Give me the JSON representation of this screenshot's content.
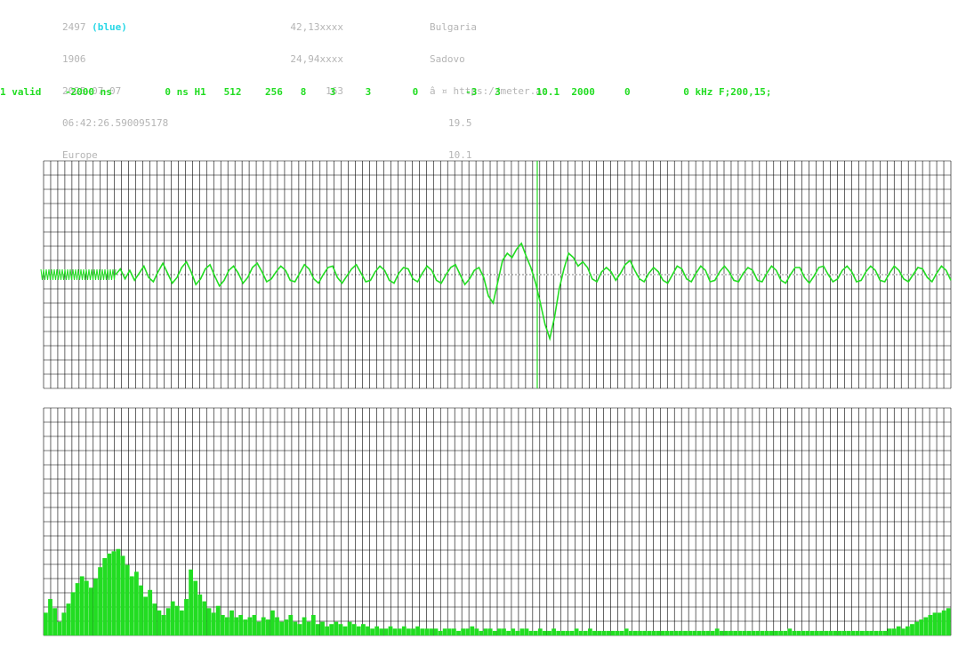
{
  "header": {
    "col1": {
      "id": "2497",
      "color_tag": "(blue)",
      "line2": "1906",
      "date": "2025-07-07",
      "time": "06:42:26.590095178",
      "region": "Europe"
    },
    "col2": {
      "lat": "42,13xxxx",
      "lon": "24,94xxxx",
      "value": "163"
    },
    "col3": {
      "country": "Bulgaria",
      "city": "Sadovo",
      "url": "â ¤ https://meter.ac",
      "val1": "19.5",
      "val2": "10.1"
    }
  },
  "status_line": "1 valid    -2000 ns         0 ns H1   512    256   8    3     3       0        -3   3      10.1  2000     0         0 kHz F;200,15;",
  "colors": {
    "signal": "#22dd22",
    "grid": "#000000",
    "header_text": "#b5b5b5",
    "accent": "#28d7e6"
  },
  "chart_data": [
    {
      "type": "line",
      "title": "",
      "xlabel": "",
      "ylabel": "",
      "x_range": [
        -2000,
        0
      ],
      "x_unit": "ns",
      "ylim": [
        -8,
        8
      ],
      "grid": true,
      "marker_line_x": -1000,
      "series": [
        {
          "values": [
            0,
            0.4,
            -0.3,
            0.3,
            -0.4,
            0.1,
            0.6,
            -0.2,
            -0.5,
            0.2,
            0.8,
            0.1,
            -0.6,
            -0.2,
            0.5,
            0.9,
            0.2,
            -0.7,
            -0.3,
            0.4,
            0.7,
            -0.1,
            -0.8,
            -0.4,
            0.3,
            0.6,
            0.1,
            -0.6,
            -0.2,
            0.5,
            0.8,
            0.2,
            -0.5,
            -0.3,
            0.2,
            0.6,
            0.3,
            -0.4,
            -0.5,
            0.1,
            0.7,
            0.4,
            -0.3,
            -0.6,
            0.0,
            0.5,
            0.6,
            -0.2,
            -0.6,
            -0.1,
            0.4,
            0.7,
            0.1,
            -0.5,
            -0.4,
            0.2,
            0.6,
            0.3,
            -0.4,
            -0.6,
            0.1,
            0.5,
            0.4,
            -0.3,
            -0.5,
            0.1,
            0.6,
            0.3,
            -0.4,
            -0.6,
            0.0,
            0.5,
            0.7,
            0.0,
            -0.7,
            -0.3,
            0.3,
            0.5,
            -0.2,
            -1.5,
            -2.0,
            -0.5,
            1.0,
            1.5,
            1.2,
            1.8,
            2.2,
            1.3,
            0.5,
            -0.6,
            -2.0,
            -3.5,
            -4.5,
            -3.0,
            -1.0,
            0.4,
            1.5,
            1.2,
            0.6,
            0.9,
            0.5,
            -0.3,
            -0.5,
            0.2,
            0.5,
            0.2,
            -0.4,
            0.1,
            0.7,
            1.0,
            0.3,
            -0.3,
            -0.5,
            0.1,
            0.5,
            0.2,
            -0.4,
            -0.6,
            0.0,
            0.6,
            0.4,
            -0.3,
            -0.5,
            0.1,
            0.6,
            0.3,
            -0.5,
            -0.4,
            0.2,
            0.6,
            0.2,
            -0.4,
            -0.5,
            0.1,
            0.5,
            0.3,
            -0.4,
            -0.5,
            0.1,
            0.6,
            0.3,
            -0.4,
            -0.6,
            0.0,
            0.5,
            0.5,
            -0.2,
            -0.6,
            -0.1,
            0.5,
            0.6,
            0.0,
            -0.5,
            -0.3,
            0.3,
            0.6,
            0.2,
            -0.5,
            -0.4,
            0.2,
            0.6,
            0.3,
            -0.4,
            -0.5,
            0.1,
            0.6,
            0.3,
            -0.3,
            -0.5,
            0.0,
            0.5,
            0.4,
            -0.2,
            -0.5,
            0.1,
            0.6,
            0.3,
            -0.4
          ]
        }
      ]
    },
    {
      "type": "bar",
      "title": "",
      "xlabel": "",
      "ylabel": "",
      "x_range": [
        0,
        200
      ],
      "x_unit": "kHz",
      "ylim": [
        0,
        10
      ],
      "grid": true,
      "values": [
        1.0,
        1.6,
        1.2,
        0.6,
        1.0,
        1.4,
        1.9,
        2.3,
        2.6,
        2.4,
        2.1,
        2.5,
        3.0,
        3.4,
        3.6,
        3.7,
        3.8,
        3.5,
        3.1,
        2.6,
        2.8,
        2.2,
        1.7,
        2.0,
        1.4,
        1.1,
        0.9,
        1.2,
        1.5,
        1.3,
        1.1,
        1.6,
        2.9,
        2.4,
        1.8,
        1.5,
        1.2,
        1.0,
        1.3,
        0.9,
        0.8,
        1.1,
        0.8,
        0.9,
        0.7,
        0.8,
        0.9,
        0.6,
        0.8,
        0.7,
        1.1,
        0.8,
        0.6,
        0.7,
        0.9,
        0.6,
        0.5,
        0.8,
        0.6,
        0.9,
        0.5,
        0.6,
        0.4,
        0.5,
        0.6,
        0.5,
        0.4,
        0.6,
        0.5,
        0.4,
        0.5,
        0.4,
        0.3,
        0.4,
        0.3,
        0.3,
        0.4,
        0.3,
        0.3,
        0.4,
        0.3,
        0.3,
        0.4,
        0.3,
        0.3,
        0.3,
        0.3,
        0.2,
        0.3,
        0.3,
        0.3,
        0.2,
        0.3,
        0.3,
        0.4,
        0.3,
        0.2,
        0.3,
        0.3,
        0.2,
        0.3,
        0.3,
        0.2,
        0.3,
        0.2,
        0.3,
        0.3,
        0.2,
        0.2,
        0.3,
        0.2,
        0.2,
        0.3,
        0.2,
        0.2,
        0.2,
        0.2,
        0.3,
        0.2,
        0.2,
        0.3,
        0.2,
        0.2,
        0.2,
        0.2,
        0.2,
        0.2,
        0.2,
        0.3,
        0.2,
        0.2,
        0.2,
        0.2,
        0.2,
        0.2,
        0.2,
        0.2,
        0.2,
        0.2,
        0.2,
        0.2,
        0.2,
        0.2,
        0.2,
        0.2,
        0.2,
        0.2,
        0.2,
        0.3,
        0.2,
        0.2,
        0.2,
        0.2,
        0.2,
        0.2,
        0.2,
        0.2,
        0.2,
        0.2,
        0.2,
        0.2,
        0.2,
        0.2,
        0.2,
        0.3,
        0.2,
        0.2,
        0.2,
        0.2,
        0.2,
        0.2,
        0.2,
        0.2,
        0.2,
        0.2,
        0.2,
        0.2,
        0.2,
        0.2,
        0.2,
        0.2,
        0.2,
        0.2,
        0.2,
        0.2,
        0.2,
        0.3,
        0.3,
        0.4,
        0.3,
        0.4,
        0.5,
        0.6,
        0.7,
        0.8,
        0.9,
        1.0,
        1.0,
        1.1,
        1.2
      ]
    }
  ]
}
